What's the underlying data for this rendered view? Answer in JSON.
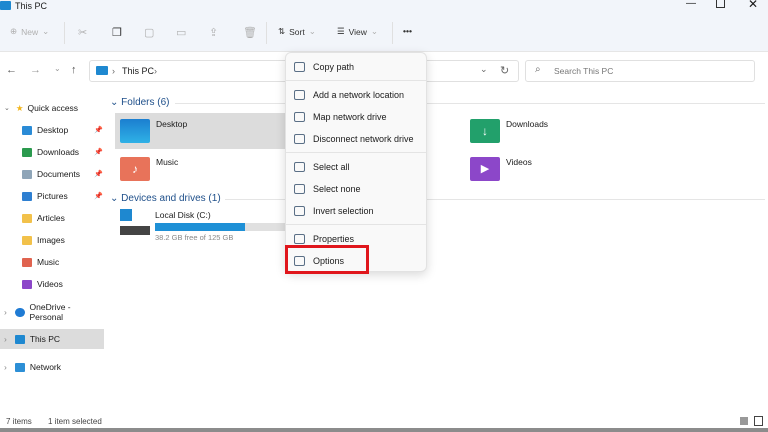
{
  "window": {
    "title": "This PC"
  },
  "toolbar": {
    "new": "New",
    "sort": "Sort",
    "view": "View",
    "more": "•••"
  },
  "address": {
    "path": "This PC",
    "separator": "›",
    "search_placeholder": "Search This PC"
  },
  "sidebar": {
    "quick_access": "Quick access",
    "items": [
      {
        "label": "Desktop",
        "pinned": true,
        "color": "#2a8bd6"
      },
      {
        "label": "Downloads",
        "pinned": true,
        "color": "#2b9a4e"
      },
      {
        "label": "Documents",
        "pinned": true,
        "color": "#8fa5b8"
      },
      {
        "label": "Pictures",
        "pinned": true,
        "color": "#2e7fd1"
      },
      {
        "label": "Articles",
        "pinned": false,
        "color": "#f2c14a"
      },
      {
        "label": "Images",
        "pinned": false,
        "color": "#f2c14a"
      },
      {
        "label": "Music",
        "pinned": false,
        "color": "#e0634f"
      },
      {
        "label": "Videos",
        "pinned": false,
        "color": "#8c47c9"
      }
    ],
    "onedrive": "OneDrive - Personal",
    "this_pc": "This PC",
    "network": "Network"
  },
  "content": {
    "folders_header": "Folders (6)",
    "folders": [
      {
        "label": "Desktop"
      },
      {
        "label": "Downloads"
      },
      {
        "label": "Music"
      },
      {
        "label": "Videos"
      }
    ],
    "drives_header": "Devices and drives (1)",
    "drive": {
      "label": "Local Disk (C:)",
      "free": "38.2 GB free of 125 GB",
      "used_fraction": 0.69
    }
  },
  "menu": {
    "items": [
      "Copy path",
      "Add a network location",
      "Map network drive",
      "Disconnect network drive",
      "Select all",
      "Select none",
      "Invert selection",
      "Properties",
      "Options"
    ]
  },
  "status": {
    "count": "7 items",
    "selected": "1 item selected"
  },
  "colors": {
    "highlight": "#e0161c",
    "accent": "#1e88d0"
  }
}
